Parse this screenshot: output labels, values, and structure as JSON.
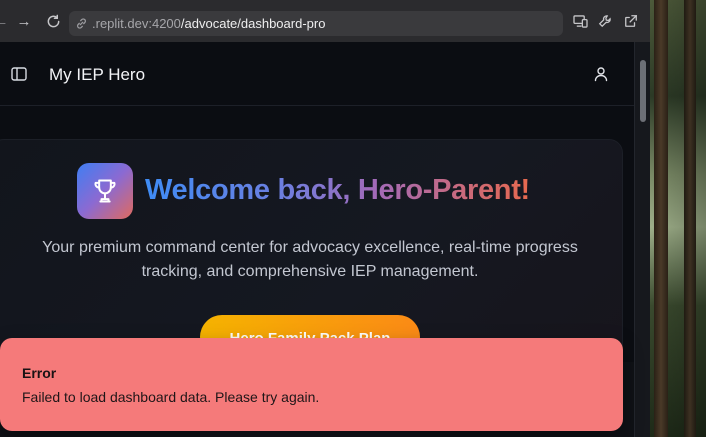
{
  "browser": {
    "url_host": ".replit.dev:4200",
    "url_path": "/advocate/dashboard-pro",
    "icons": [
      "back-arrow-icon",
      "forward-arrow-icon",
      "reload-icon",
      "link-icon",
      "devices-icon",
      "wrench-icon",
      "open-external-icon"
    ]
  },
  "header": {
    "app_title": "My IEP Hero",
    "icons": [
      "sidebar-toggle-icon",
      "user-icon"
    ]
  },
  "welcome": {
    "title": "Welcome back, Hero-Parent!",
    "subtitle": "Your premium command center for advocacy excellence, real-time progress tracking, and comprehensive IEP management.",
    "plan_button": "Hero Family Pack Plan",
    "icon": "trophy-icon"
  },
  "toast": {
    "title": "Error",
    "message": "Failed to load dashboard data. Please try again."
  },
  "colors": {
    "toast_bg": "#f57a7a",
    "plan_gradient_start": "#f5b300",
    "plan_gradient_end": "#fb8a16",
    "title_gradient_start": "#3f8cf5",
    "title_gradient_end": "#e7694e"
  }
}
